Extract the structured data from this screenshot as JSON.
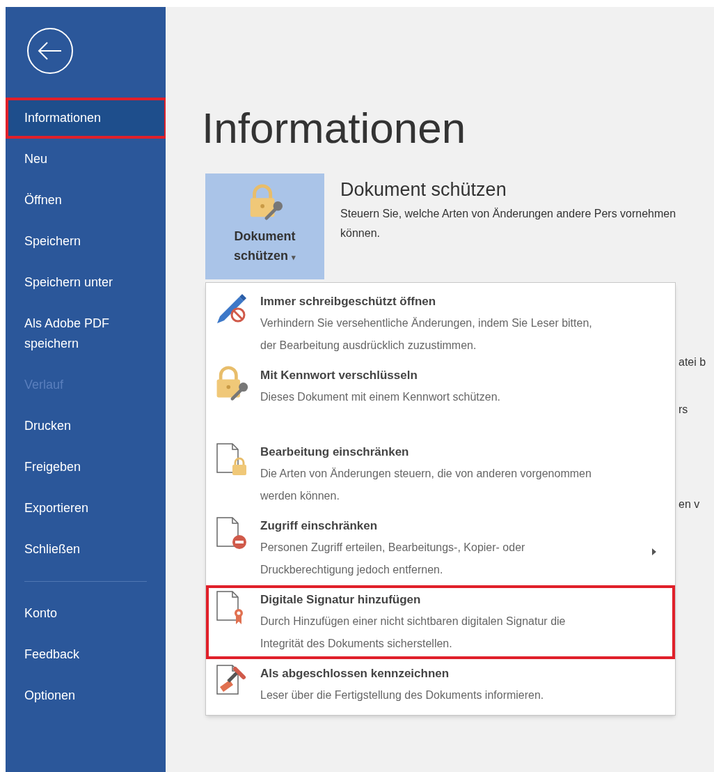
{
  "sidebar": {
    "sections": [
      {
        "items": [
          {
            "label": "Informationen",
            "selected": true,
            "disabled": false,
            "highlighted": true
          },
          {
            "label": "Neu",
            "selected": false,
            "disabled": false,
            "highlighted": false
          },
          {
            "label": "Öffnen",
            "selected": false,
            "disabled": false,
            "highlighted": false
          },
          {
            "label": "Speichern",
            "selected": false,
            "disabled": false,
            "highlighted": false
          },
          {
            "label": "Speichern unter",
            "selected": false,
            "disabled": false,
            "highlighted": false
          },
          {
            "label": "Als Adobe PDF speichern",
            "selected": false,
            "disabled": false,
            "highlighted": false
          },
          {
            "label": "Verlauf",
            "selected": false,
            "disabled": true,
            "highlighted": false
          },
          {
            "label": "Drucken",
            "selected": false,
            "disabled": false,
            "highlighted": false
          },
          {
            "label": "Freigeben",
            "selected": false,
            "disabled": false,
            "highlighted": false
          },
          {
            "label": "Exportieren",
            "selected": false,
            "disabled": false,
            "highlighted": false
          },
          {
            "label": "Schließen",
            "selected": false,
            "disabled": false,
            "highlighted": false
          }
        ]
      },
      {
        "items": [
          {
            "label": "Konto",
            "selected": false,
            "disabled": false,
            "highlighted": false
          },
          {
            "label": "Feedback",
            "selected": false,
            "disabled": false,
            "highlighted": false
          },
          {
            "label": "Optionen",
            "selected": false,
            "disabled": false,
            "highlighted": false
          }
        ]
      }
    ]
  },
  "page_title": "Informationen",
  "protect": {
    "button_lines": [
      "Dokument",
      "schützen"
    ],
    "caret": "▾",
    "heading": "Dokument schützen",
    "description": "Steuern Sie, welche Arten von Änderungen andere Pers vornehmen können."
  },
  "background_fragments": [
    "atei b",
    "rs",
    "en v"
  ],
  "menu": [
    {
      "kind": "pencil",
      "title": "Immer schreibgeschützt öffnen",
      "description": "Verhindern Sie versehentliche Änderungen, indem Sie Leser bitten, der Bearbeitung ausdrücklich zuzustimmen.",
      "submenu": false,
      "highlighted": false
    },
    {
      "kind": "lock",
      "title": "Mit Kennwort verschlüsseln",
      "description": "Dieses Dokument mit einem Kennwort schützen.",
      "submenu": false,
      "highlighted": false
    },
    {
      "kind": "doc-lock",
      "title": "Bearbeitung einschränken",
      "description": "Die Arten von Änderungen steuern, die von anderen vorgenommen werden können.",
      "submenu": false,
      "highlighted": false
    },
    {
      "kind": "doc-block",
      "title": "Zugriff einschränken",
      "description": "Personen Zugriff erteilen, Bearbeitungs-, Kopier- oder Druckberechtigung jedoch entfernen.",
      "submenu": true,
      "highlighted": false
    },
    {
      "kind": "doc-ribbon",
      "title": "Digitale Signatur hinzufügen",
      "description": "Durch Hinzufügen einer nicht sichtbaren digitalen Signatur die Integrität des Dokuments sicherstellen.",
      "submenu": false,
      "highlighted": true
    },
    {
      "kind": "doc-stamp",
      "title": "Als abgeschlossen kennzeichnen",
      "description": "Leser über die Fertigstellung des Dokuments informieren.",
      "submenu": false,
      "highlighted": false
    }
  ]
}
